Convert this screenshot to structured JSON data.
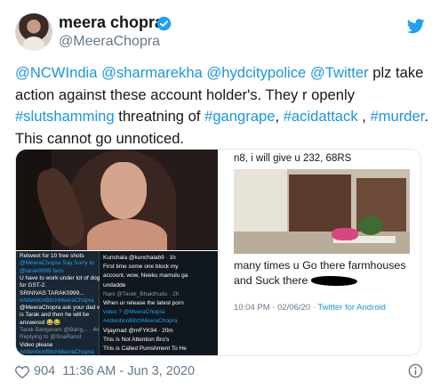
{
  "author": {
    "name": "meera chopra",
    "handle": "@MeeraChopra"
  },
  "tweet": {
    "segments": [
      {
        "text": "@NCWIndia",
        "link": true
      },
      {
        "text": " ",
        "link": false
      },
      {
        "text": "@sharmarekha",
        "link": true
      },
      {
        "text": " ",
        "link": false
      },
      {
        "text": "@hydcitypolice",
        "link": true
      },
      {
        "text": " ",
        "link": false
      },
      {
        "text": "@Twitter",
        "link": true
      },
      {
        "text": " plz take action against these account holder's. They r openly ",
        "link": false
      },
      {
        "text": "#slutshamming",
        "link": true
      },
      {
        "text": "  threatning of ",
        "link": false
      },
      {
        "text": "#gangrape",
        "link": true
      },
      {
        "text": ", ",
        "link": false
      },
      {
        "text": "#acidattack",
        "link": true
      },
      {
        "text": " , ",
        "link": false
      },
      {
        "text": "#murder",
        "link": true
      },
      {
        "text": ". This cannot go unnoticed.",
        "link": false
      }
    ]
  },
  "media": {
    "dm_left": [
      {
        "text": "Retweet for 10 free shots",
        "cls": ""
      },
      {
        "text": "@MeeraChopra Say Sorry to",
        "cls": "dm-blue"
      },
      {
        "text": "@tarak9999 fans",
        "cls": "dm-blue"
      },
      {
        "text": "U have to work under lot of dogs",
        "cls": ""
      },
      {
        "text": "for GST-2.",
        "cls": ""
      },
      {
        "text": "SRINIVAS TARAK0999...",
        "cls": ""
      },
      {
        "text": "#AttentionBitchMeeraChopra",
        "cls": "dm-blue"
      },
      {
        "text": "@MeeraChopra ask your dad who",
        "cls": ""
      },
      {
        "text": "is Tarak and then he will be",
        "cls": ""
      },
      {
        "text": "answered 😂😂",
        "cls": ""
      },
      {
        "text": "Tarak Bangaram @Bang... · 4m",
        "cls": "dm-grey"
      },
      {
        "text": "Replying to @SnaRanst",
        "cls": "dm-grey"
      },
      {
        "text": "Video please",
        "cls": ""
      },
      {
        "text": "#AttentionBitchMeeraChopra",
        "cls": "dm-blue"
      }
    ],
    "dm_right": [
      {
        "text": "Kunchala @kunchalab9 · 1h",
        "cls": ""
      },
      {
        "text": "First time some one block my",
        "cls": ""
      },
      {
        "text": "account, wow, Neeku mamulu ga",
        "cls": ""
      },
      {
        "text": "undadde",
        "cls": ""
      },
      {
        "text": "Nani @Tarak_Bhakthudu · 2h",
        "cls": "dm-grey"
      },
      {
        "text": "When ur release the latest porn",
        "cls": ""
      },
      {
        "text": "video ? @MeeraChopra",
        "cls": "dm-blue"
      },
      {
        "text": "#AttentionBitchMeeraChopra",
        "cls": "dm-blue"
      },
      {
        "text": "Vijaymad @mFYK94 · 20m",
        "cls": ""
      },
      {
        "text": "This is Not Attention Bro's",
        "cls": ""
      },
      {
        "text": "This is Called Punishment To He",
        "cls": ""
      }
    ],
    "right_caption_top": "n8, i will give u 232, 68RS",
    "right_caption_bottom_1": "many times u Go there farmhouses",
    "right_caption_bottom_2": "and Suck there",
    "right_meta_time": "10:04 PM · 02/06/20 · ",
    "right_meta_source": "Twitter for Android"
  },
  "footer": {
    "likes": "904",
    "date": "11:36 AM - Jun 3, 2020"
  },
  "colors": {
    "link": "#1b95e0",
    "verified": "#1da1f2",
    "secondary": "#657786"
  },
  "icons": {
    "verified": "verified-badge-icon",
    "bird": "twitter-bird-icon",
    "heart": "heart-icon",
    "info": "info-icon"
  }
}
